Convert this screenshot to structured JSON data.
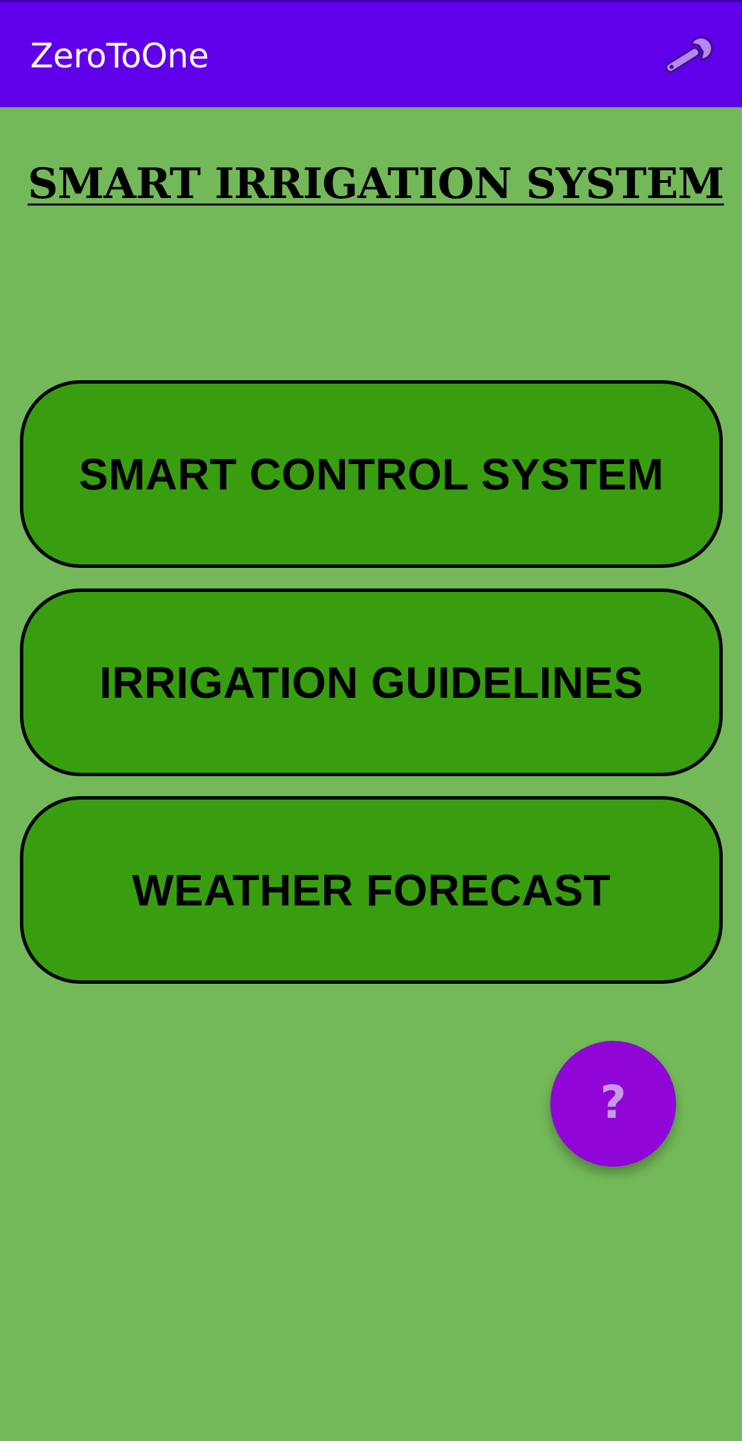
{
  "app_bar": {
    "title": "ZeroToOne",
    "action_icon": "wrench-icon",
    "color": "#6000ea"
  },
  "main": {
    "title": "SMART IRRIGATION SYSTEM",
    "buttons": [
      {
        "label": "SMART CONTROL SYSTEM"
      },
      {
        "label": "IRRIGATION GUIDELINES"
      },
      {
        "label": "WEATHER FORECAST"
      }
    ],
    "button_color": "#389e10",
    "background_color": "#73b959"
  },
  "fab": {
    "label": "?",
    "icon": "help-icon",
    "color": "#8f06d6"
  }
}
